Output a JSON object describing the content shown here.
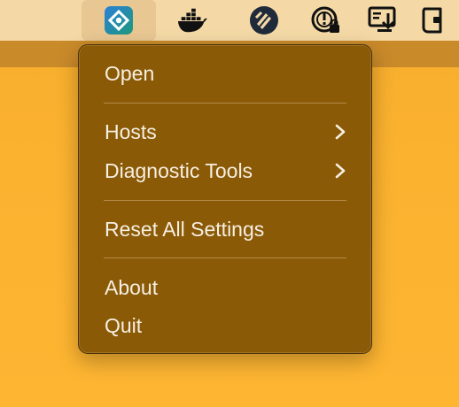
{
  "menubar": {
    "icons": [
      {
        "name": "hosts-app-icon",
        "active": true
      },
      {
        "name": "docker-icon"
      },
      {
        "name": "app-shield-icon"
      },
      {
        "name": "vpn-lock-icon"
      },
      {
        "name": "download-display-icon"
      },
      {
        "name": "wallet-icon"
      }
    ]
  },
  "menu": {
    "items": {
      "open": "Open",
      "hosts": "Hosts",
      "diagnostic_tools": "Diagnostic Tools",
      "reset_all_settings": "Reset All Settings",
      "about": "About",
      "quit": "Quit"
    }
  },
  "colors": {
    "menu_bg": "#8a5a06",
    "menu_text": "#f7efe2",
    "menubar_bg": "#f4d9a6",
    "desktop": "#fbb22f"
  }
}
